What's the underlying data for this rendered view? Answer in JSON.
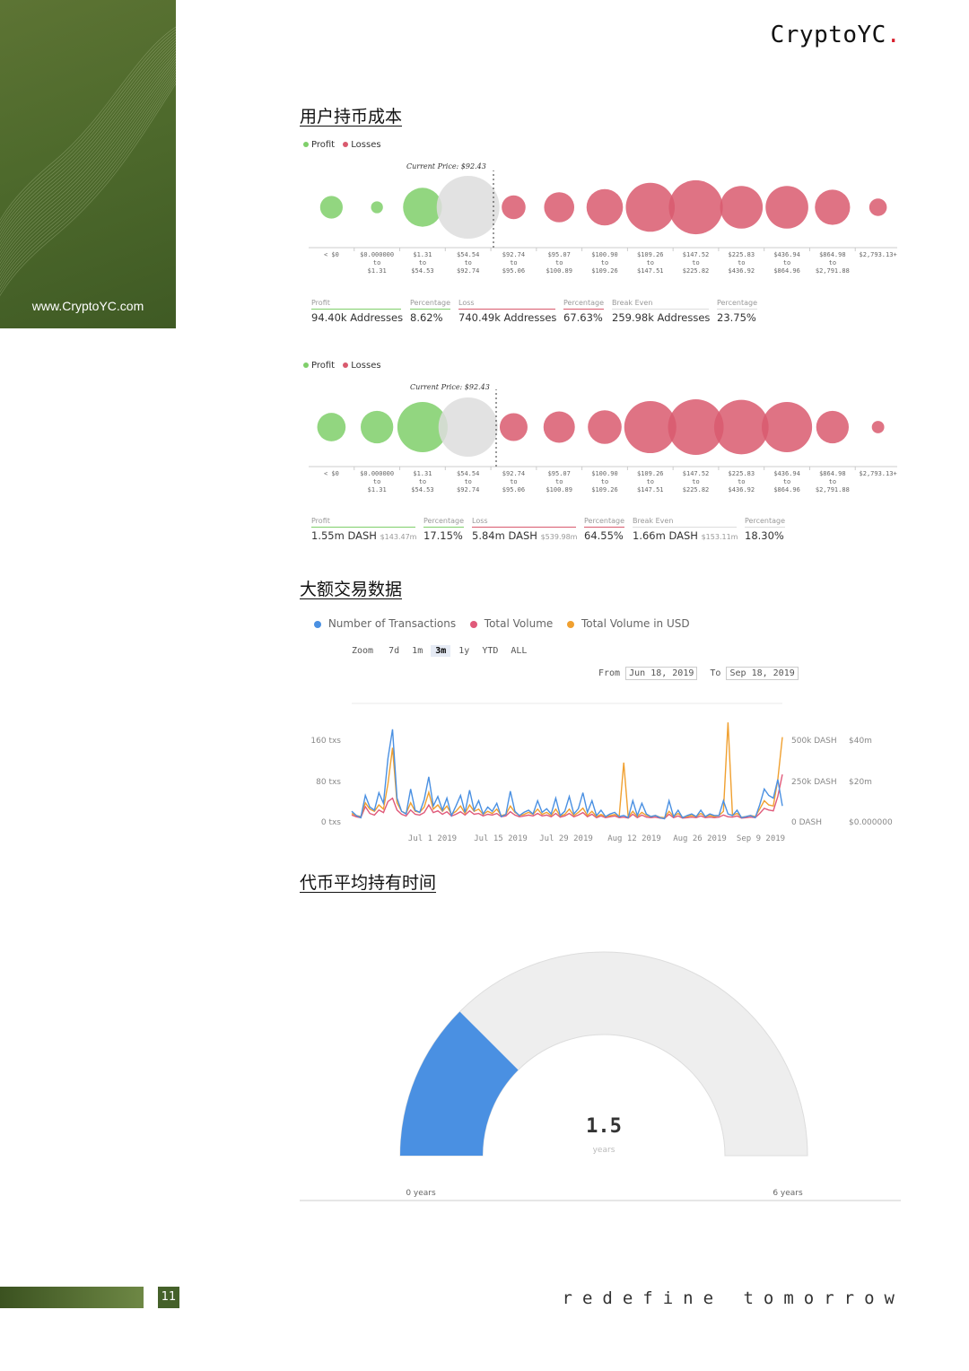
{
  "brand": {
    "name": "CryptoYC",
    "dot": ".",
    "url": "www.CryptoYC.com"
  },
  "sections": {
    "cost": "用户持币成本",
    "large_tx": "大额交易数据",
    "hold_time": "代币平均持有时间"
  },
  "colors": {
    "profit": "#7fcf6a",
    "loss": "#d95a6e",
    "breakeven": "#dddddd",
    "tx": "#4a90e2",
    "vol": "#e05a7a",
    "usd": "#f0a030",
    "gauge_fill": "#4a90e2",
    "gauge_bg": "#eeeeee",
    "accent_green": "#4e6a2c"
  },
  "bubble_legend": {
    "profit": "Profit",
    "loss": "Losses"
  },
  "current_price": "Current Price: $92.43",
  "price_ranges": [
    {
      "top": "< $0",
      "mid": "",
      "bot": ""
    },
    {
      "top": "$0.000000",
      "mid": "to",
      "bot": "$1.31"
    },
    {
      "top": "$1.31",
      "mid": "to",
      "bot": "$54.53"
    },
    {
      "top": "$54.54",
      "mid": "to",
      "bot": "$92.74"
    },
    {
      "top": "$92.74",
      "mid": "to",
      "bot": "$95.06"
    },
    {
      "top": "$95.07",
      "mid": "to",
      "bot": "$100.89"
    },
    {
      "top": "$100.90",
      "mid": "to",
      "bot": "$109.26"
    },
    {
      "top": "$109.26",
      "mid": "to",
      "bot": "$147.51"
    },
    {
      "top": "$147.52",
      "mid": "to",
      "bot": "$225.82"
    },
    {
      "top": "$225.83",
      "mid": "to",
      "bot": "$436.92"
    },
    {
      "top": "$436.94",
      "mid": "to",
      "bot": "$864.96"
    },
    {
      "top": "$864.98",
      "mid": "to",
      "bot": "$2,791.88"
    },
    {
      "top": "$2,793.13+",
      "mid": "",
      "bot": ""
    }
  ],
  "chart1_stats": {
    "profit_lbl": "Profit",
    "profit_val": "94.40k Addresses",
    "pct1_lbl": "Percentage",
    "pct1_val": "8.62%",
    "loss_lbl": "Loss",
    "loss_val": "740.49k Addresses",
    "pct2_lbl": "Percentage",
    "pct2_val": "67.63%",
    "be_lbl": "Break Even",
    "be_val": "259.98k Addresses",
    "pct3_lbl": "Percentage",
    "pct3_val": "23.75%"
  },
  "chart2_stats": {
    "profit_lbl": "Profit",
    "profit_val": "1.55m DASH",
    "profit_sub": "$143.47m",
    "pct1_lbl": "Percentage",
    "pct1_val": "17.15%",
    "loss_lbl": "Loss",
    "loss_val": "5.84m DASH",
    "loss_sub": "$539.98m",
    "pct2_lbl": "Percentage",
    "pct2_val": "64.55%",
    "be_lbl": "Break Even",
    "be_val": "1.66m DASH",
    "be_sub": "$153.11m",
    "pct3_lbl": "Percentage",
    "pct3_val": "18.30%"
  },
  "tx_legend": {
    "tx": "Number of Transactions",
    "vol": "Total Volume",
    "usd": "Total Volume in USD"
  },
  "zoom": {
    "label": "Zoom",
    "options": [
      "7d",
      "1m",
      "3m",
      "1y",
      "YTD",
      "ALL"
    ],
    "active": "3m"
  },
  "range": {
    "from_label": "From",
    "from": "Jun 18, 2019",
    "to_label": "To",
    "to": "Sep 18, 2019"
  },
  "tx_axes": {
    "left": [
      "160 txs",
      "80 txs",
      "0 txs"
    ],
    "right1": [
      "500k DASH",
      "250k DASH",
      "0 DASH"
    ],
    "right2": [
      "$40m",
      "$20m",
      "$0.000000"
    ],
    "x": [
      "Jul 1 2019",
      "Jul 15 2019",
      "Jul 29 2019",
      "Aug 12 2019",
      "Aug 26 2019",
      "Sep 9 2019"
    ]
  },
  "gauge": {
    "value": "1.5",
    "unit": "years",
    "min": "0 years",
    "max": "6 years",
    "fraction": 0.25
  },
  "footer": {
    "page": "11",
    "tagline": "redefine tomorrow"
  },
  "chart_data": [
    {
      "type": "scatter",
      "title": "",
      "categories": [
        "< $0",
        "$0.000000 to $1.31",
        "$1.31 to $54.53",
        "$54.54 to $92.74",
        "$92.74 to $95.06",
        "$95.07 to $100.89",
        "$100.90 to $109.26",
        "$109.26 to $147.51",
        "$147.52 to $225.82",
        "$225.83 to $436.92",
        "$436.94 to $864.96",
        "$864.98 to $2,791.88",
        "$2,793.13+"
      ],
      "status": [
        "profit",
        "profit",
        "profit",
        "breakeven",
        "loss",
        "loss",
        "loss",
        "loss",
        "loss",
        "loss",
        "loss",
        "loss",
        "loss"
      ],
      "relative_size": [
        0.36,
        0.19,
        0.62,
        1.0,
        0.38,
        0.48,
        0.58,
        0.78,
        0.86,
        0.68,
        0.68,
        0.56,
        0.28
      ]
    },
    {
      "type": "scatter",
      "title": "",
      "categories": [
        "< $0",
        "$0.000000 to $1.31",
        "$1.31 to $54.53",
        "$54.54 to $92.74",
        "$92.74 to $95.06",
        "$95.07 to $100.89",
        "$100.90 to $109.26",
        "$109.26 to $147.51",
        "$147.52 to $225.82",
        "$225.83 to $436.92",
        "$436.94 to $864.96",
        "$864.98 to $2,791.88",
        "$2,793.13+"
      ],
      "status": [
        "profit",
        "profit",
        "profit",
        "breakeven",
        "loss",
        "loss",
        "loss",
        "loss",
        "loss",
        "loss",
        "loss",
        "loss",
        "loss"
      ],
      "relative_size": [
        0.48,
        0.55,
        0.85,
        1.0,
        0.47,
        0.53,
        0.57,
        0.88,
        0.94,
        0.92,
        0.85,
        0.55,
        0.21
      ]
    },
    {
      "type": "line",
      "title": "",
      "x_start": "Jun 18 2019",
      "x_end": "Sep 18 2019",
      "series": [
        {
          "name": "Number of Transactions",
          "axis": "txs",
          "values": [
            20,
            12,
            8,
            50,
            28,
            22,
            55,
            35,
            120,
            175,
            45,
            20,
            15,
            62,
            22,
            18,
            42,
            85,
            30,
            48,
            22,
            45,
            12,
            30,
            50,
            18,
            60,
            22,
            40,
            15,
            28,
            20,
            35,
            10,
            14,
            58,
            20,
            12,
            18,
            22,
            15,
            40,
            18,
            25,
            15,
            45,
            12,
            20,
            48,
            15,
            25,
            55,
            18,
            40,
            12,
            22,
            10,
            15,
            18,
            10,
            12,
            8,
            40,
            12,
            35,
            15,
            10,
            12,
            8,
            6,
            40,
            10,
            22,
            8,
            12,
            15,
            10,
            22,
            10,
            15,
            12,
            12,
            40,
            15,
            12,
            22,
            8,
            10,
            12,
            8,
            32,
            62,
            50,
            45,
            80,
            30
          ]
        },
        {
          "name": "Total Volume",
          "axis": "dash",
          "values": [
            40000,
            30000,
            25000,
            90000,
            50000,
            40000,
            70000,
            55000,
            120000,
            140000,
            70000,
            45000,
            35000,
            70000,
            45000,
            40000,
            55000,
            100000,
            55000,
            65000,
            45000,
            60000,
            35000,
            45000,
            60000,
            40000,
            65000,
            45000,
            50000,
            35000,
            45000,
            40000,
            50000,
            30000,
            35000,
            60000,
            40000,
            30000,
            35000,
            40000,
            35000,
            50000,
            35000,
            40000,
            30000,
            50000,
            28000,
            35000,
            50000,
            30000,
            40000,
            55000,
            30000,
            45000,
            25000,
            35000,
            25000,
            30000,
            35000,
            25000,
            28000,
            22000,
            45000,
            25000,
            40000,
            28000,
            25000,
            28000,
            22000,
            20000,
            45000,
            25000,
            35000,
            22000,
            25000,
            28000,
            25000,
            35000,
            25000,
            28000,
            25000,
            28000,
            40000,
            30000,
            28000,
            35000,
            22000,
            25000,
            28000,
            25000,
            50000,
            80000,
            70000,
            65000,
            150000,
            280000
          ]
        },
        {
          "name": "Total Volume in USD",
          "axis": "usd",
          "values": [
            4000000,
            3000000,
            2500000,
            9000000,
            6000000,
            5000000,
            8000000,
            6000000,
            18000000,
            35000000,
            9000000,
            5000000,
            4000000,
            9000000,
            5000000,
            4500000,
            7000000,
            14000000,
            6000000,
            8000000,
            5000000,
            7500000,
            3500000,
            5000000,
            7500000,
            4000000,
            8000000,
            5000000,
            6000000,
            3500000,
            5000000,
            4000000,
            6000000,
            3000000,
            3500000,
            7500000,
            4500000,
            3000000,
            3500000,
            4500000,
            3500000,
            6000000,
            3500000,
            4500000,
            3000000,
            6000000,
            2800000,
            3500000,
            6000000,
            3000000,
            4500000,
            6500000,
            3000000,
            5000000,
            2500000,
            3500000,
            2500000,
            3000000,
            3500000,
            2500000,
            28000000,
            2200000,
            5000000,
            2500000,
            4500000,
            3000000,
            2500000,
            3000000,
            2200000,
            2000000,
            5000000,
            2500000,
            4000000,
            2200000,
            2500000,
            3000000,
            2500000,
            4000000,
            2500000,
            3000000,
            2500000,
            3000000,
            5000000,
            47000000,
            3000000,
            4000000,
            2200000,
            2500000,
            3000000,
            2500000,
            6000000,
            10000000,
            8000000,
            7500000,
            20000000,
            40000000
          ]
        }
      ],
      "ylim_txs": [
        0,
        200
      ],
      "ylim_dash": [
        0,
        625000
      ],
      "ylim_usd": [
        0,
        50000000
      ]
    },
    {
      "type": "gauge",
      "title": "",
      "value": 1.5,
      "min": 0,
      "max": 6,
      "unit": "years"
    }
  ]
}
